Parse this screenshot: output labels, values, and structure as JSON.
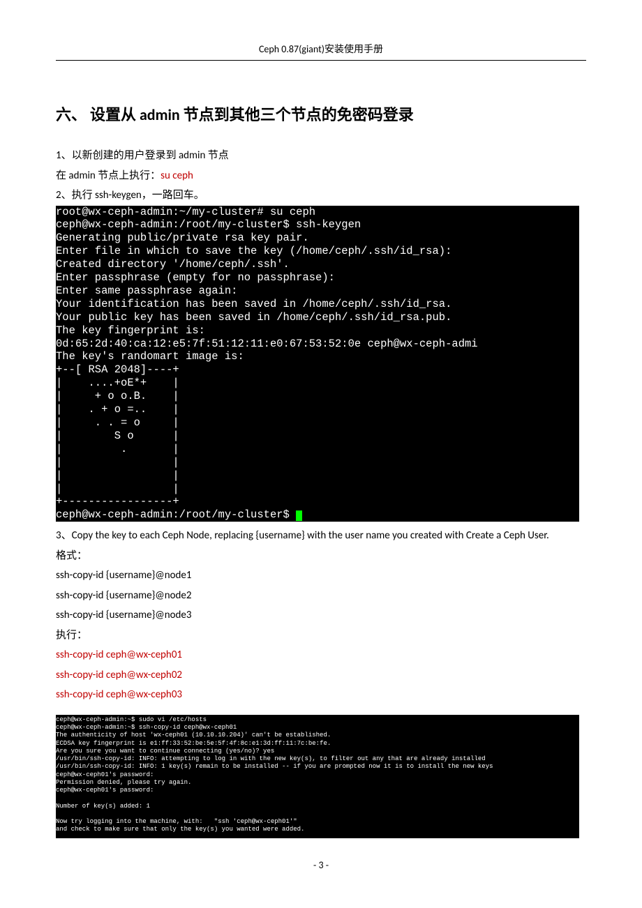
{
  "header": {
    "title": "Ceph 0.87(giant)安装使用手册"
  },
  "section": {
    "title": "六、 设置从 admin 节点到其他三个节点的免密码登录"
  },
  "p": {
    "l1": "1、以新创建的用户登录到 admin 节点",
    "l2a": "在 admin 节点上执行：",
    "l2b": "su ceph",
    "l3": "2、执行 ssh-keygen，一路回车。",
    "l4": "3、Copy the key to each Ceph Node, replacing {username} with the user name you created with Create a Ceph User.",
    "l5": "格式：",
    "l6": "ssh-copy-id {username}@node1",
    "l7": "ssh-copy-id {username}@node2",
    "l8": "ssh-copy-id {username}@node3",
    "l9": "执行：",
    "l10": "ssh-copy-id ceph@wx-ceph01",
    "l11": "ssh-copy-id ceph@wx-ceph02",
    "l12": "ssh-copy-id ceph@wx-ceph03"
  },
  "term1": {
    "t1": "root@wx-ceph-admin:~/my-cluster# su ceph",
    "t2": "ceph@wx-ceph-admin:/root/my-cluster$ ssh-keygen",
    "t3": "Generating public/private rsa key pair.",
    "t4": "Enter file in which to save the key (/home/ceph/.ssh/id_rsa):",
    "t5": "Created directory '/home/ceph/.ssh'.",
    "t6": "Enter passphrase (empty for no passphrase):",
    "t7": "Enter same passphrase again:",
    "t8": "Your identification has been saved in /home/ceph/.ssh/id_rsa.",
    "t9": "Your public key has been saved in /home/ceph/.ssh/id_rsa.pub.",
    "t10": "The key fingerprint is:",
    "t11": "0d:65:2d:40:ca:12:e5:7f:51:12:11:e0:67:53:52:0e ceph@wx-ceph-admi",
    "t12": "The key's randomart image is:",
    "t13": "+--[ RSA 2048]----+",
    "t14": "|    ....+oE*+    |",
    "t15": "|     + o o.B.    |",
    "t16": "|    . + o =..    |",
    "t17": "|     . . = o     |",
    "t18": "|        S o      |",
    "t19": "|         .       |",
    "t20": "|                 |",
    "t21": "|                 |",
    "t22": "|                 |",
    "t23": "+-----------------+",
    "t24": "ceph@wx-ceph-admin:/root/my-cluster$ "
  },
  "term2": {
    "u1": "ceph@wx-ceph-admin:~$ sudo vi /etc/hosts",
    "u2": "ceph@wx-ceph-admin:~$ ssh-copy-id ceph@wx-ceph01",
    "u3": "The authenticity of host 'wx-ceph01 (10.10.10.204)' can't be established.",
    "u4": "ECDSA key fingerprint is e1:ff:33:52:be:5e:5f:4f:8c:e1:3d:ff:11:7c:be:fe.",
    "u5": "Are you sure you want to continue connecting (yes/no)? yes",
    "u6": "/usr/bin/ssh-copy-id: INFO: attempting to log in with the new key(s), to filter out any that are already installed",
    "u7": "/usr/bin/ssh-copy-id: INFO: 1 key(s) remain to be installed -- if you are prompted now it is to install the new keys",
    "u8": "ceph@wx-ceph01's password:",
    "u9": "Permission denied, please try again.",
    "u10": "ceph@wx-ceph01's password:",
    "u11": "",
    "u12": "Number of key(s) added: 1",
    "u13": "",
    "u14": "Now try logging into the machine, with:   \"ssh 'ceph@wx-ceph01'\"",
    "u15": "and check to make sure that only the key(s) you wanted were added."
  },
  "footer": {
    "page": "- 3 -"
  }
}
